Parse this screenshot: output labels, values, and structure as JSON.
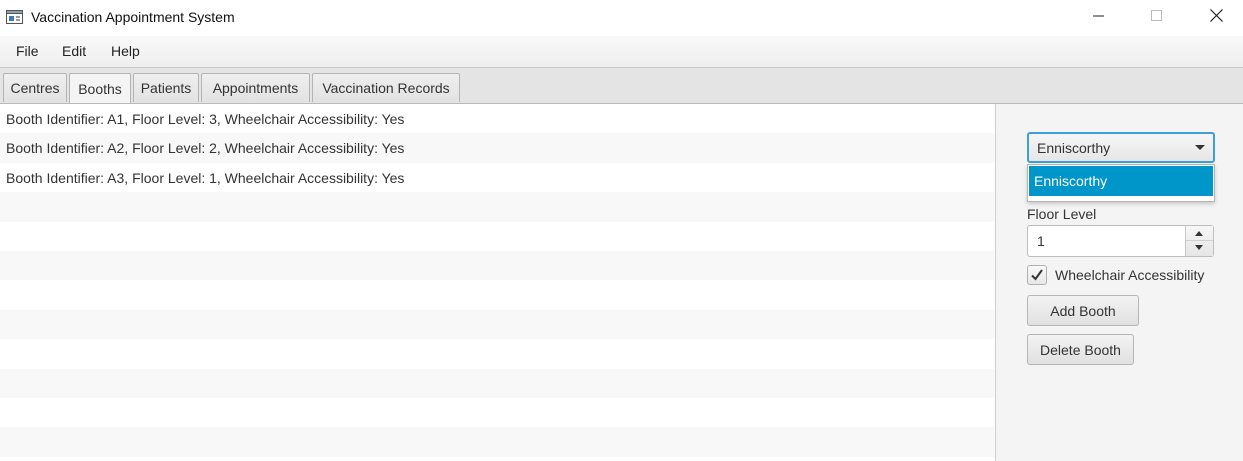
{
  "window": {
    "title": "Vaccination Appointment System",
    "icon": "app-window-icon",
    "controls": [
      "minimize-icon",
      "maximize-icon",
      "close-icon"
    ]
  },
  "menubar": {
    "items": [
      {
        "label": "File"
      },
      {
        "label": "Edit"
      },
      {
        "label": "Help"
      }
    ]
  },
  "tabs": [
    {
      "label": "Centres",
      "selected": false
    },
    {
      "label": "Booths",
      "selected": true
    },
    {
      "label": "Patients",
      "selected": false
    },
    {
      "label": "Appointments",
      "selected": false
    },
    {
      "label": "Vaccination Records",
      "selected": false
    }
  ],
  "booths_list": {
    "items": [
      "Booth Identifier: A1, Floor Level: 3, Wheelchair Accessibility: Yes",
      "Booth Identifier: A2, Floor Level: 2, Wheelchair Accessibility: Yes",
      "Booth Identifier: A3, Floor Level: 1, Wheelchair Accessibility: Yes"
    ]
  },
  "form": {
    "centre_combo": {
      "selected": "Enniscorthy",
      "options": [
        "Enniscorthy"
      ]
    },
    "floor_level_label": "Floor Level",
    "floor_level_value": "1",
    "wheelchair_label": "Wheelchair Accessibility",
    "wheelchair_checked": true,
    "add_button": "Add Booth",
    "delete_button": "Delete Booth"
  },
  "colors": {
    "accent": "#0096c9",
    "focus_border": "#3e9fd8"
  }
}
